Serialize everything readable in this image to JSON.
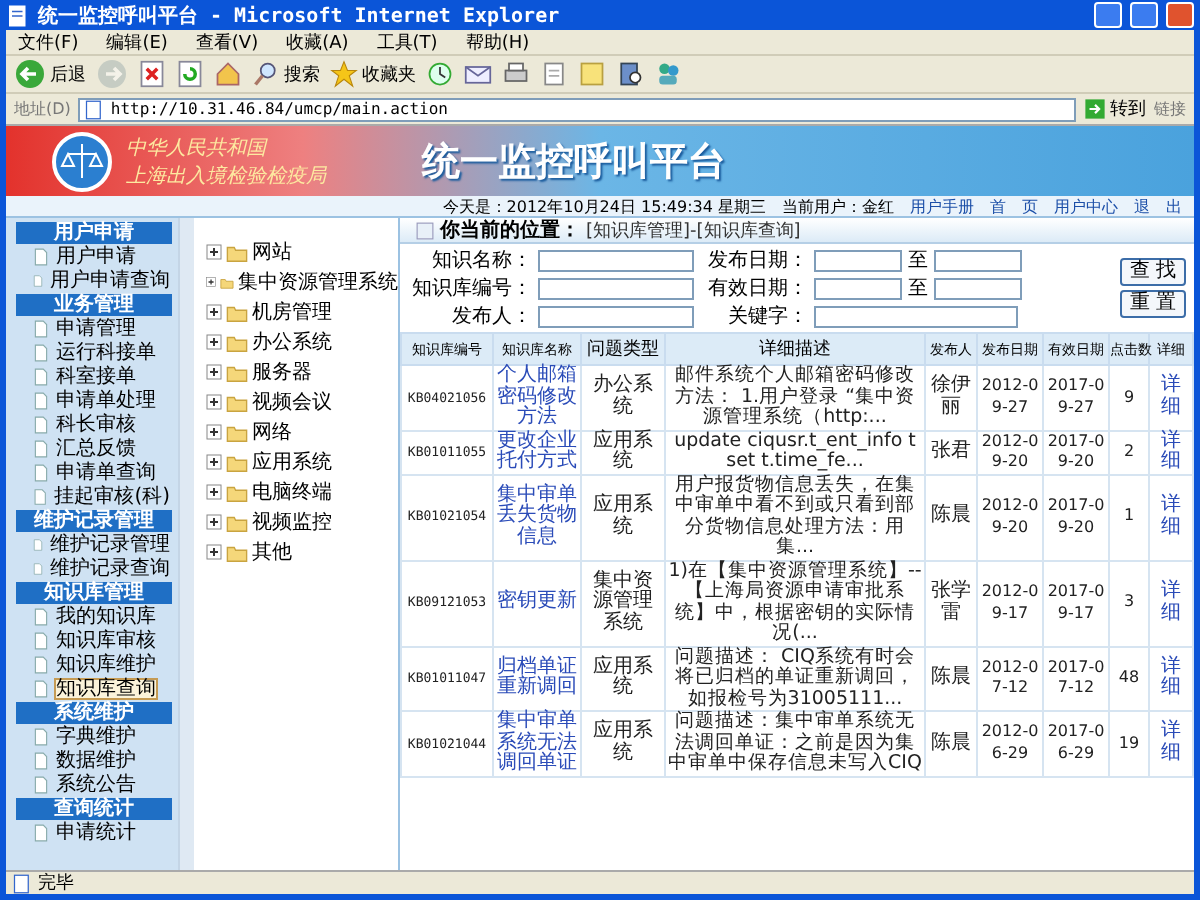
{
  "window": {
    "title": "统一监控呼叫平台 - Microsoft Internet Explorer"
  },
  "menu": [
    "文件(F)",
    "编辑(E)",
    "查看(V)",
    "收藏(A)",
    "工具(T)",
    "帮助(H)"
  ],
  "toolbar": [
    {
      "kind": "back",
      "label": "后退",
      "disabled": false
    },
    {
      "kind": "forward",
      "disabled": true
    },
    {
      "kind": "stop",
      "disabled": false
    },
    {
      "kind": "refresh",
      "disabled": false
    },
    {
      "kind": "home",
      "disabled": false
    },
    {
      "kind": "search",
      "label": "搜索",
      "disabled": false
    },
    {
      "kind": "favorites",
      "label": "收藏夹",
      "disabled": false
    },
    {
      "kind": "history",
      "disabled": false
    },
    {
      "kind": "mail",
      "disabled": false
    },
    {
      "kind": "print",
      "disabled": false
    },
    {
      "kind": "edit",
      "disabled": false
    },
    {
      "kind": "note",
      "disabled": false
    },
    {
      "kind": "research",
      "disabled": false
    },
    {
      "kind": "messenger",
      "disabled": false
    }
  ],
  "address": {
    "label": "地址(D)",
    "url": "http://10.31.46.84/umcp/main.action",
    "go": "转到",
    "links": "链接"
  },
  "banner": {
    "org_line_1": "中华人民共和国",
    "org_line_2": "上海出入境检验检疫局",
    "title": "统一监控呼叫平台"
  },
  "info_bar": {
    "date": "今天是：2012年10月24日 15:49:34 星期三",
    "user": "当前用户：金红",
    "links": [
      "用户手册",
      "首　页",
      "用户中心",
      "退　出"
    ]
  },
  "sidebar": [
    {
      "title": "用户申请",
      "items": [
        {
          "label": "用户申请",
          "selected": false
        },
        {
          "label": "用户申请查询",
          "selected": false
        }
      ]
    },
    {
      "title": "业务管理",
      "items": [
        {
          "label": "申请管理",
          "selected": false
        },
        {
          "label": "运行科接单",
          "selected": false
        },
        {
          "label": "科室接单",
          "selected": false
        },
        {
          "label": "申请单处理",
          "selected": false
        },
        {
          "label": "科长审核",
          "selected": false
        },
        {
          "label": "汇总反馈",
          "selected": false
        },
        {
          "label": "申请单查询",
          "selected": false
        },
        {
          "label": "挂起审核(科)",
          "selected": false
        }
      ]
    },
    {
      "title": "维护记录管理",
      "items": [
        {
          "label": "维护记录管理",
          "selected": false
        },
        {
          "label": "维护记录查询",
          "selected": false
        }
      ]
    },
    {
      "title": "知识库管理",
      "items": [
        {
          "label": "我的知识库",
          "selected": false
        },
        {
          "label": "知识库审核",
          "selected": false
        },
        {
          "label": "知识库维护",
          "selected": false
        },
        {
          "label": "知识库查询",
          "selected": true
        }
      ]
    },
    {
      "title": "系统维护",
      "items": [
        {
          "label": "字典维护",
          "selected": false
        },
        {
          "label": "数据维护",
          "selected": false
        },
        {
          "label": "系统公告",
          "selected": false
        }
      ]
    },
    {
      "title": "查询统计",
      "items": [
        {
          "label": "申请统计",
          "selected": false
        }
      ]
    }
  ],
  "tree": [
    {
      "label": "网站",
      "expanded": false
    },
    {
      "label": "集中资源管理系统",
      "expanded": false
    },
    {
      "label": "机房管理",
      "expanded": false
    },
    {
      "label": "办公系统",
      "expanded": false
    },
    {
      "label": "服务器",
      "expanded": false
    },
    {
      "label": "视频会议",
      "expanded": false
    },
    {
      "label": "网络",
      "expanded": false
    },
    {
      "label": "应用系统",
      "expanded": false
    },
    {
      "label": "电脑终端",
      "expanded": false
    },
    {
      "label": "视频监控",
      "expanded": false
    },
    {
      "label": "其他",
      "expanded": false
    }
  ],
  "breadcrumb": {
    "label": "你当前的位置：",
    "path": "[知识库管理]-[知识库查询]"
  },
  "search_form": {
    "name_label": "知识名称：",
    "number_label": "知识库编号：",
    "publisher_label": "发布人：",
    "publish_date_label": "发布日期：",
    "valid_date_label": "有效日期：",
    "keyword_label": "关键字：",
    "to_1": "至",
    "to_2": "至",
    "buttons": [
      "查 找",
      "重 置"
    ]
  },
  "table": {
    "columns": [
      "知识库编号",
      "知识库名称",
      "问题类型",
      "详细描述",
      "发布人",
      "发布日期",
      "有效日期",
      "点击数",
      "详细"
    ],
    "rows": [
      [
        "KB04021056",
        "个人邮箱密码修改方法",
        "办公系统",
        "邮件系统个人邮箱密码修改方法： 1.用户登录 “集中资源管理系统（http:...",
        "徐伊丽",
        "2012-09-27",
        "2017-09-27",
        "9",
        "详细"
      ],
      [
        "KB01011055",
        "更改企业托付方式",
        "应用系统",
        "update ciqusr.t_ent_info t set t.time_fe...",
        "张君",
        "2012-09-20",
        "2017-09-20",
        "2",
        "详细"
      ],
      [
        "KB01021054",
        "集中审单丢失货物信息",
        "应用系统",
        "用户报货物信息丢失，在集中审单中看不到或只看到部分货物信息处理方法：用集...",
        "陈晨",
        "2012-09-20",
        "2017-09-20",
        "1",
        "详细"
      ],
      [
        "KB09121053",
        "密钥更新",
        "集中资源管理系统",
        "1)在【集中资源管理系统】--【上海局资源申请审批系统】中，根据密钥的实际情况(...",
        "张学雷",
        "2012-09-17",
        "2017-09-17",
        "3",
        "详细"
      ],
      [
        "KB01011047",
        "归档单证重新调回",
        "应用系统",
        "问题描述： CIQ系统有时会将已归档的单证重新调回，如报检号为31005111...",
        "陈晨",
        "2012-07-12",
        "2017-07-12",
        "48",
        "详细"
      ],
      [
        "KB01021044",
        "集中审单系统无法调回单证",
        "应用系统",
        "问题描述：集中审单系统无法调回单证：之前是因为集中审单中保存信息未写入CIQ",
        "陈晨",
        "2012-06-29",
        "2017-06-29",
        "19",
        "详细"
      ]
    ]
  },
  "status_bar": {
    "text": "完毕"
  }
}
